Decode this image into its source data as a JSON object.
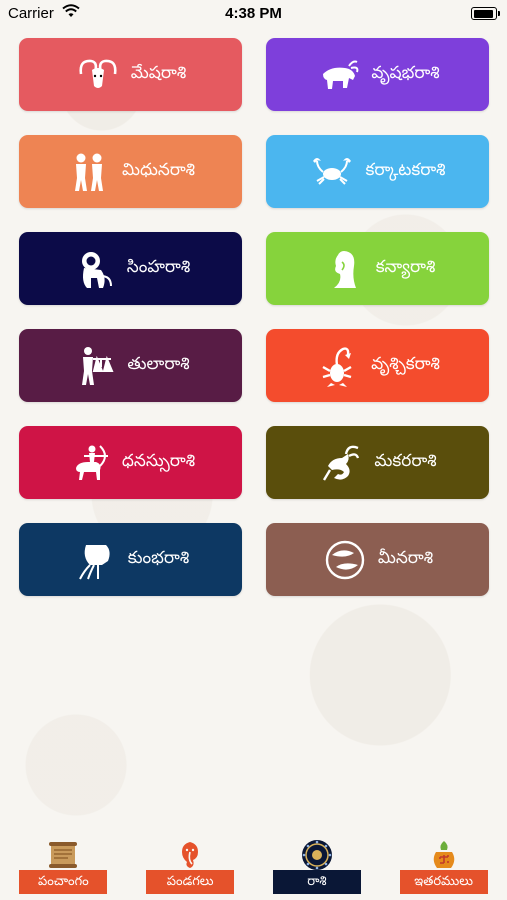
{
  "status_bar": {
    "carrier": "Carrier",
    "time": "4:38 PM"
  },
  "rasis": [
    {
      "label": "మేషరాశి",
      "color": "#e55a60",
      "icon": "aries-icon"
    },
    {
      "label": "వృషభరాశి",
      "color": "#7e3fdb",
      "icon": "taurus-icon"
    },
    {
      "label": "మిధునరాశి",
      "color": "#ee8453",
      "icon": "gemini-icon"
    },
    {
      "label": "కర్కాటకరాశి",
      "color": "#4bb6ef",
      "icon": "cancer-icon"
    },
    {
      "label": "సింహరాశి",
      "color": "#0c0b48",
      "icon": "leo-icon"
    },
    {
      "label": "కన్యారాశి",
      "color": "#86d33c",
      "icon": "virgo-icon"
    },
    {
      "label": "తులారాశి",
      "color": "#581c45",
      "icon": "libra-icon"
    },
    {
      "label": "వృశ్చికరాశి",
      "color": "#f44c2d",
      "icon": "scorpio-icon"
    },
    {
      "label": "ధనస్సురాశి",
      "color": "#cf1446",
      "icon": "sagittarius-icon"
    },
    {
      "label": "మకరరాశి",
      "color": "#5a4e0c",
      "icon": "capricorn-icon"
    },
    {
      "label": "కుంభరాశి",
      "color": "#0d3863",
      "icon": "aquarius-icon"
    },
    {
      "label": "మీనరాశి",
      "color": "#8c5e51",
      "icon": "pisces-icon"
    }
  ],
  "tabs": [
    {
      "label": "పంచాంగం",
      "icon": "panchangam-scroll-icon",
      "active": false
    },
    {
      "label": "పండగలు",
      "icon": "ganesha-icon",
      "active": false
    },
    {
      "label": "రాశి",
      "icon": "zodiac-wheel-icon",
      "active": true
    },
    {
      "label": "ఇతరములు",
      "icon": "kalasam-icon",
      "active": false
    }
  ]
}
